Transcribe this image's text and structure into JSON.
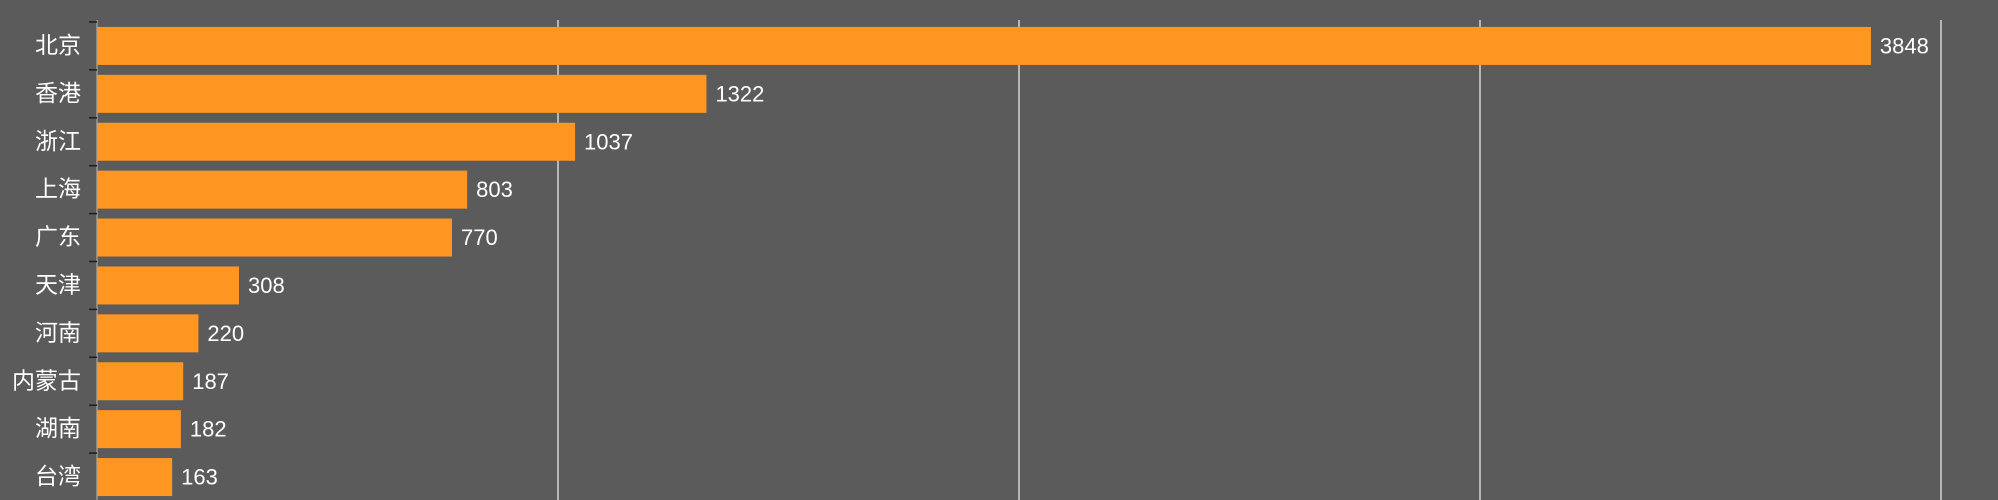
{
  "chart_data": {
    "type": "bar",
    "orientation": "horizontal",
    "categories": [
      "北京",
      "香港",
      "浙江",
      "上海",
      "广东",
      "天津",
      "河南",
      "内蒙古",
      "湖南",
      "台湾"
    ],
    "values": [
      3848,
      1322,
      1037,
      803,
      770,
      308,
      220,
      187,
      182,
      163
    ],
    "xlim": [
      0,
      4000
    ],
    "x_gridlines": [
      1000,
      2000,
      3000,
      4000
    ],
    "grid": true,
    "data_labels": true,
    "colors": {
      "background": "#5b5b5b",
      "bar": "#ff9622",
      "text": "#ffffff",
      "grid": "#e8e8e8"
    }
  }
}
